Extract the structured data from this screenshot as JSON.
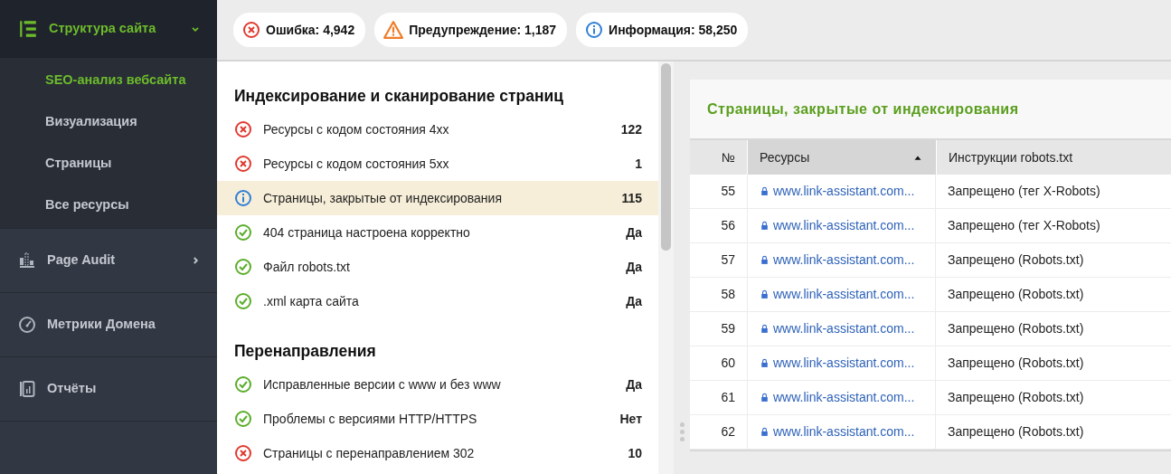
{
  "sidebar": {
    "items": [
      {
        "kind": "structure",
        "label": "Структура сайта",
        "expanded": true,
        "selected": true,
        "children": [
          {
            "label": "SEO-анализ вебсайта",
            "selected": true
          },
          {
            "label": "Визуализация",
            "selected": false
          },
          {
            "label": "Страницы",
            "selected": false
          },
          {
            "label": "Все ресурсы",
            "selected": false
          }
        ]
      },
      {
        "kind": "audit",
        "label": "Page Audit",
        "expanded": false,
        "selected": false
      },
      {
        "kind": "metrics",
        "label": "Метрики Домена",
        "selected": false
      },
      {
        "kind": "reports",
        "label": "Отчёты",
        "selected": false
      }
    ]
  },
  "summary": [
    {
      "kind": "error",
      "label": "Ошибка: 4,942"
    },
    {
      "kind": "warning",
      "label": "Предупреждение: 1,187"
    },
    {
      "kind": "info",
      "label": "Информация: 58,250"
    }
  ],
  "checks": {
    "sections": [
      {
        "title": "Индексирование и сканирование страниц",
        "items": [
          {
            "kind": "error",
            "label": "Ресурсы с кодом состояния 4xx",
            "value": "122",
            "selected": false
          },
          {
            "kind": "error",
            "label": "Ресурсы с кодом состояния 5xx",
            "value": "1",
            "selected": false
          },
          {
            "kind": "info",
            "label": "Страницы, закрытые от индексирования",
            "value": "115",
            "selected": true
          },
          {
            "kind": "ok",
            "label": "404 страница настроена корректно",
            "value": "Да",
            "selected": false
          },
          {
            "kind": "ok",
            "label": "Файл robots.txt",
            "value": "Да",
            "selected": false
          },
          {
            "kind": "ok",
            "label": ".xml карта сайта",
            "value": "Да",
            "selected": false
          }
        ]
      },
      {
        "title": "Перенаправления",
        "items": [
          {
            "kind": "ok",
            "label": "Исправленные версии с www и без www",
            "value": "Да",
            "selected": false
          },
          {
            "kind": "ok",
            "label": "Проблемы с версиями HTTP/HTTPS",
            "value": "Нет",
            "selected": false
          },
          {
            "kind": "error",
            "label": "Страницы с перенаправлением 302",
            "value": "10",
            "selected": false
          }
        ]
      }
    ]
  },
  "detail": {
    "title": "Страницы, закрытые от индексирования",
    "table": {
      "columns": [
        {
          "label": "№",
          "sorted": false
        },
        {
          "label": "Ресурсы",
          "sorted": true
        },
        {
          "label": "Инструкции robots.txt",
          "sorted": false
        }
      ],
      "rows": [
        {
          "number": "55",
          "resource": "www.link-assistant.com...",
          "instruction": "Запрещено (тег X-Robots)"
        },
        {
          "number": "56",
          "resource": "www.link-assistant.com...",
          "instruction": "Запрещено (тег X-Robots)"
        },
        {
          "number": "57",
          "resource": "www.link-assistant.com...",
          "instruction": "Запрещено (Robots.txt)"
        },
        {
          "number": "58",
          "resource": "www.link-assistant.com...",
          "instruction": "Запрещено (Robots.txt)"
        },
        {
          "number": "59",
          "resource": "www.link-assistant.com...",
          "instruction": "Запрещено (Robots.txt)"
        },
        {
          "number": "60",
          "resource": "www.link-assistant.com...",
          "instruction": "Запрещено (Robots.txt)"
        },
        {
          "number": "61",
          "resource": "www.link-assistant.com...",
          "instruction": "Запрещено (Robots.txt)"
        },
        {
          "number": "62",
          "resource": "www.link-assistant.com...",
          "instruction": "Запрещено (Robots.txt)"
        }
      ]
    }
  }
}
